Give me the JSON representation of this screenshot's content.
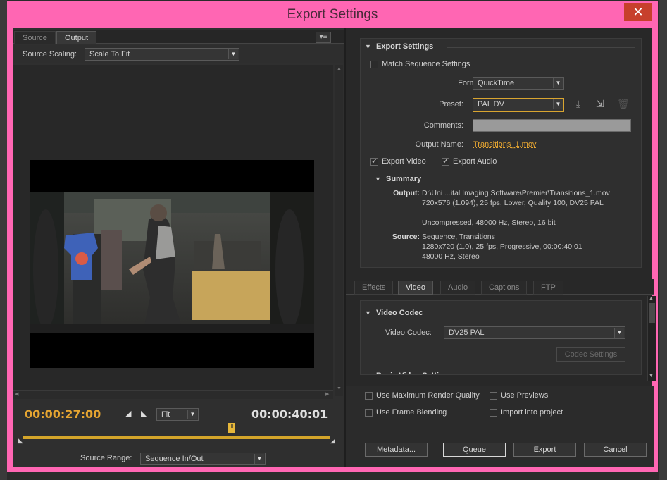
{
  "window": {
    "title": "Export Settings",
    "close_label": "✕"
  },
  "left": {
    "tabs": [
      "Source",
      "Output"
    ],
    "panel_menu": "▾≡",
    "source_scaling_label": "Source Scaling:",
    "source_scaling_value": "Scale To Fit",
    "current_time": "00:00:27:00",
    "fit_value": "Fit",
    "end_time": "00:00:40:01",
    "source_range_label": "Source Range:",
    "source_range_value": "Sequence In/Out",
    "playhead_progress": 0.68
  },
  "export_settings": {
    "header": "Export Settings",
    "match_sequence": {
      "label": "Match Sequence Settings",
      "checked": false
    },
    "format_label": "Format:",
    "format_value": "QuickTime",
    "preset_label": "Preset:",
    "preset_value": "PAL DV",
    "comments_label": "Comments:",
    "output_name_label": "Output Name:",
    "output_name_value": "Transitions_1.mov",
    "export_video": {
      "label": "Export Video",
      "checked": true
    },
    "export_audio": {
      "label": "Export Audio",
      "checked": true
    },
    "summary": {
      "header": "Summary",
      "output_label": "Output:",
      "output_lines": [
        "D:\\Uni ...ital Imaging Software\\Premier\\Transitions_1.mov",
        "720x576 (1.094), 25 fps, Lower, Quality 100, DV25 PAL",
        "",
        "Uncompressed, 48000 Hz, Stereo, 16 bit"
      ],
      "source_label": "Source:",
      "source_lines": [
        "Sequence, Transitions",
        "1280x720 (1.0), 25 fps, Progressive, 00:00:40:01",
        "48000 Hz, Stereo"
      ]
    }
  },
  "settings_tabs": [
    "Effects",
    "Video",
    "Audio",
    "Captions",
    "FTP"
  ],
  "active_settings_tab": "Video",
  "video_codec": {
    "header": "Video Codec",
    "label": "Video Codec:",
    "value": "DV25 PAL",
    "codec_settings_button": "Codec Settings",
    "next_section": "Basic Video Settings"
  },
  "options": {
    "max_render_quality": {
      "label": "Use Maximum Render Quality",
      "checked": false
    },
    "use_previews": {
      "label": "Use Previews",
      "checked": false
    },
    "frame_blending": {
      "label": "Use Frame Blending",
      "checked": false
    },
    "import_into_project": {
      "label": "Import into project",
      "checked": false
    }
  },
  "buttons": {
    "metadata": "Metadata...",
    "queue": "Queue",
    "export": "Export",
    "cancel": "Cancel"
  },
  "colors": {
    "accent": "#e6b73a",
    "window_frame": "#ff66b3",
    "close": "#c7402c",
    "link": "#e6a531"
  }
}
